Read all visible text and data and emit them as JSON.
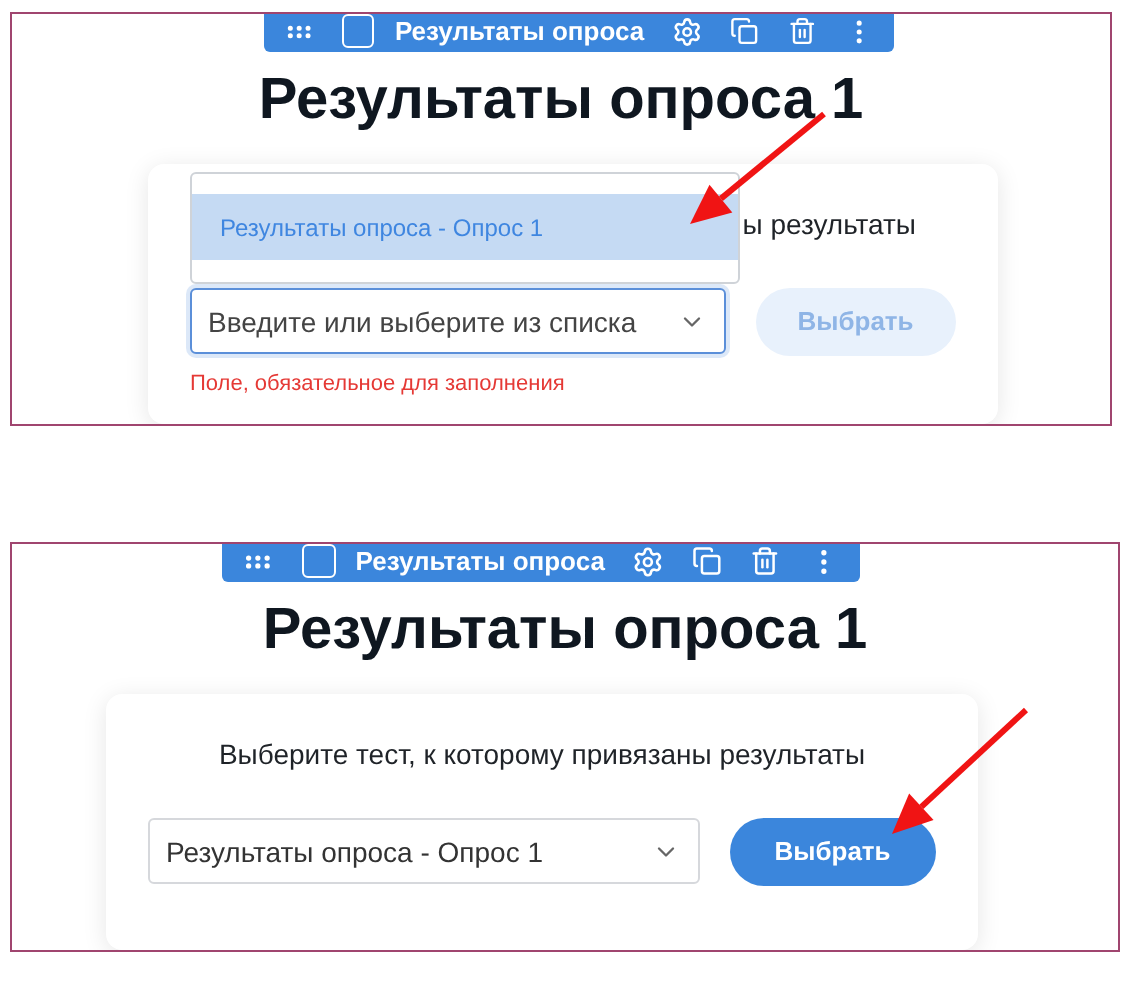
{
  "panels": [
    {
      "toolbar": {
        "title": "Результаты опроса",
        "checked": false
      },
      "heading": "Результаты опроса 1",
      "card": {
        "label": "ы результаты",
        "dropdown": {
          "options": [
            {
              "label": "Результаты опроса - Опрос 1",
              "selected": true
            }
          ]
        },
        "field": {
          "placeholder": "Введите или выберите из списка",
          "focused": true
        },
        "button": {
          "label": "Выбрать",
          "disabled": true
        },
        "error": "Поле, обязательное для заполнения"
      }
    },
    {
      "toolbar": {
        "title": "Результаты опроса",
        "checked": false
      },
      "heading": "Результаты опроса 1",
      "card": {
        "label": "Выберите тест, к которому привязаны результаты",
        "field": {
          "value": "Результаты опроса - Опрос 1",
          "focused": false
        },
        "button": {
          "label": "Выбрать",
          "disabled": false
        }
      }
    }
  ]
}
